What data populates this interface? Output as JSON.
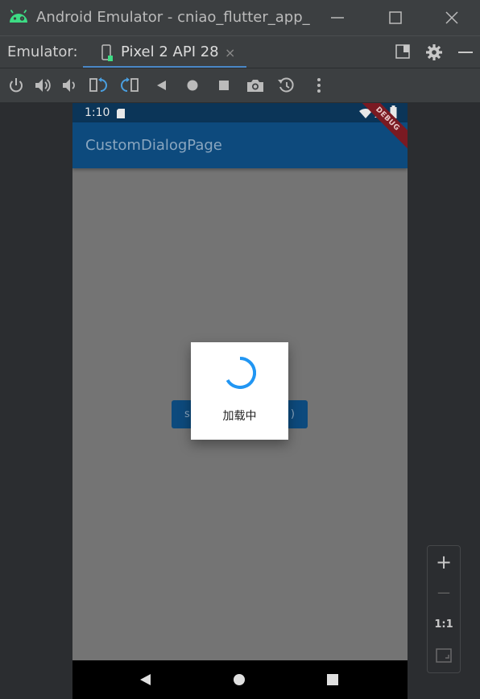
{
  "window": {
    "title": "Android Emulator - cniao_flutter_app_r",
    "icons": [
      "android-icon",
      "minimize-icon",
      "maximize-icon",
      "close-icon"
    ]
  },
  "tabbar": {
    "label": "Emulator:",
    "tab_name": "Pixel 2 API 28",
    "tab_close": "×"
  },
  "toolbar": {
    "icons": [
      "power-icon",
      "volume-up-icon",
      "volume-down-icon",
      "rotate-left-icon",
      "rotate-right-icon",
      "back-icon",
      "home-icon",
      "overview-icon",
      "screenshot-icon",
      "snapshot-icon",
      "more-icon"
    ]
  },
  "device": {
    "status_time": "1:10",
    "appbar_title": "CustomDialogPage",
    "debug_banner": "DEBUG",
    "underlying_button": {
      "left_text": "s",
      "right_text": ")"
    },
    "dialog_text": "加载中",
    "spinner_color": "#2196f3",
    "accent": "#0d4a7d"
  },
  "zoom": {
    "plus": "+",
    "minus": "—",
    "one_to_one": "1:1"
  },
  "colors": {
    "tab_underline": "#4a88c7",
    "active_toolbar": "#4a9fe0"
  }
}
